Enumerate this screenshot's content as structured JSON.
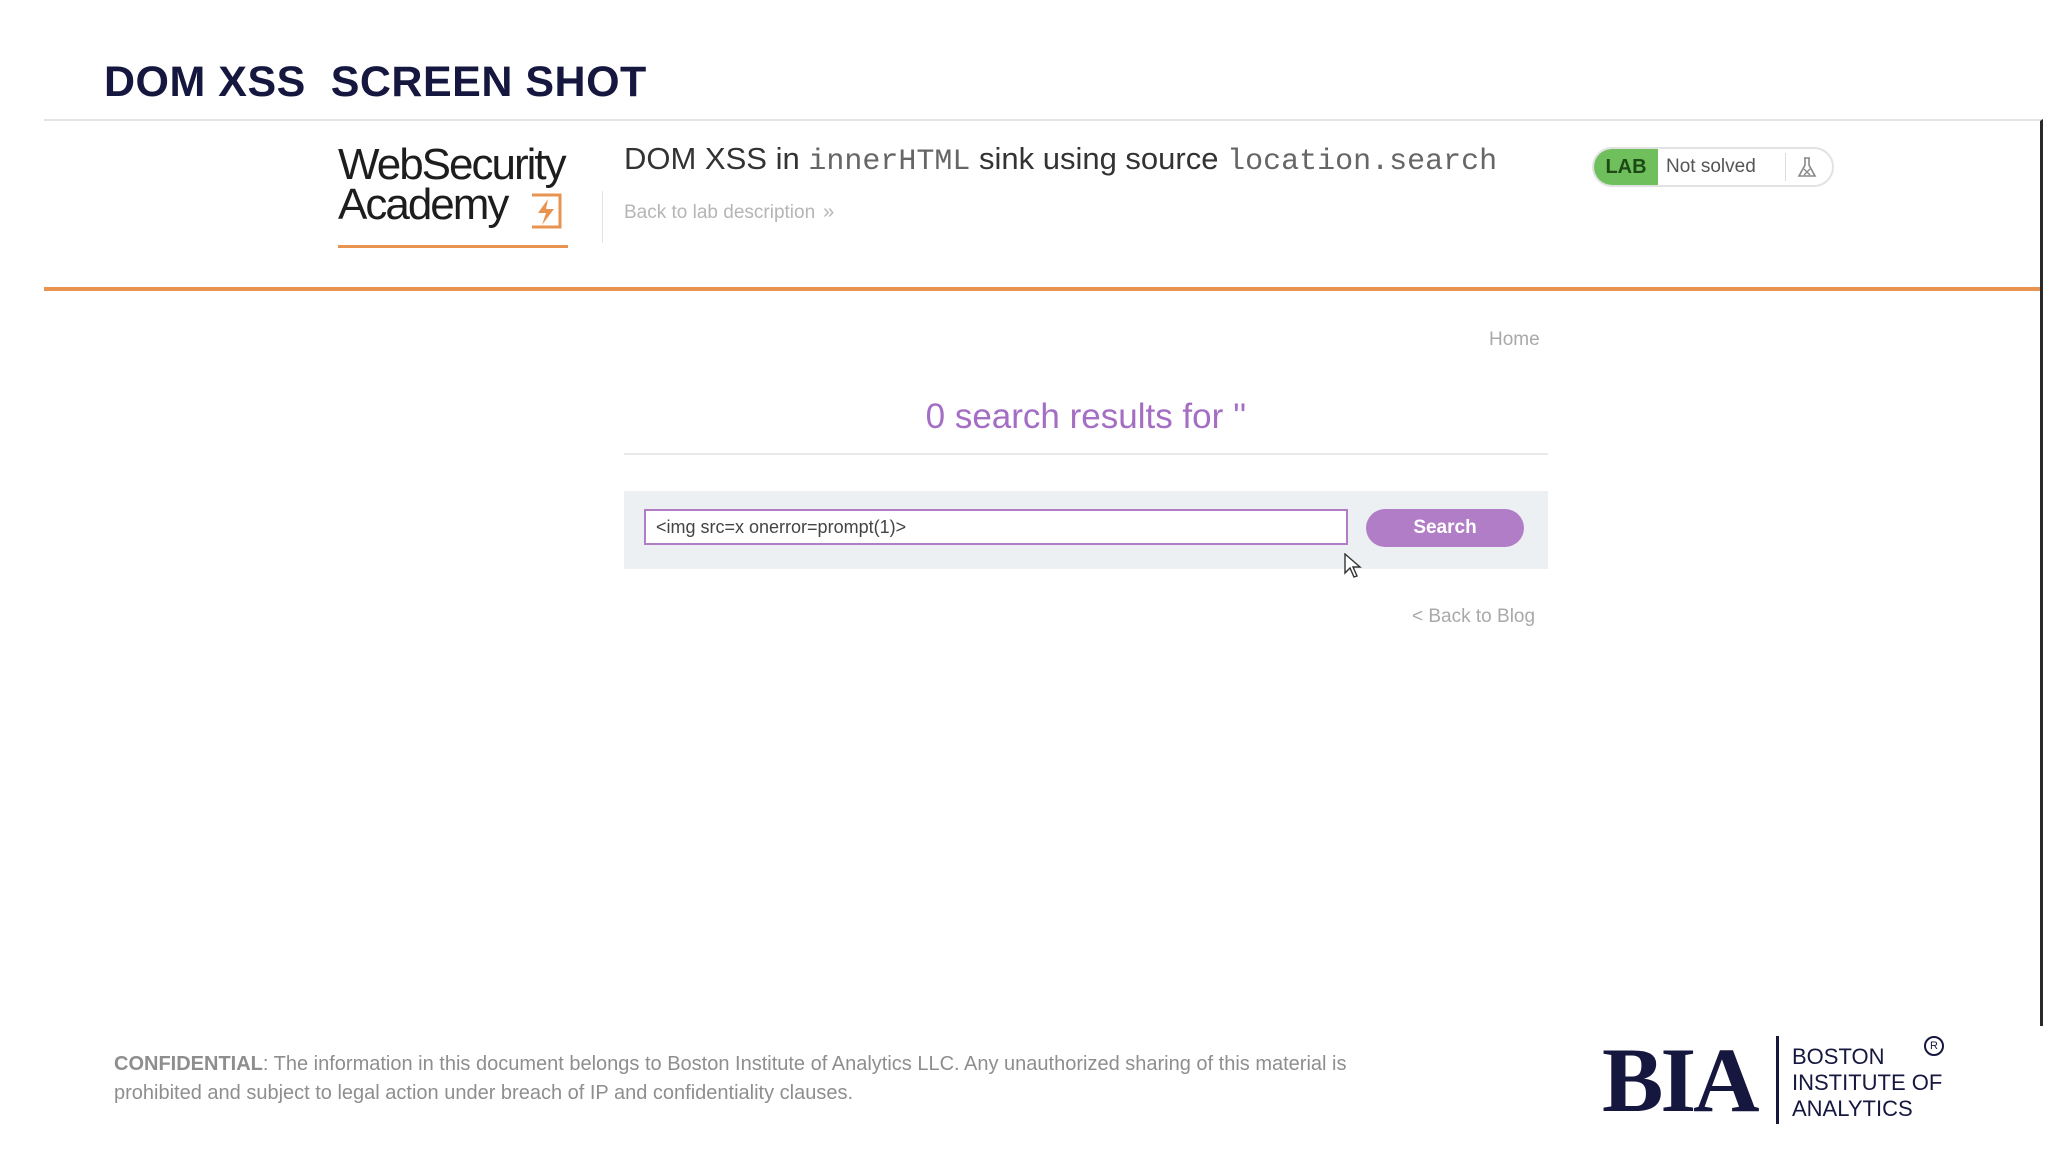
{
  "slide": {
    "title": "DOM XSS  SCREEN SHOT"
  },
  "lab": {
    "logo": {
      "line1": "WebSecurity",
      "line2": "Academy"
    },
    "title_parts": {
      "prefix": "DOM XSS in ",
      "sink": "innerHTML",
      "middle": " sink using source ",
      "source": "location.search"
    },
    "back_link": "Back to lab description",
    "back_link_chevron": "»",
    "status": {
      "badge": "LAB",
      "text": "Not solved"
    },
    "accent_color": "#e8934f"
  },
  "blog": {
    "home_link": "Home",
    "results_heading": "0 search results for ''",
    "search": {
      "value": "<img src=x onerror=prompt(1)>",
      "button_label": "Search"
    },
    "back_to_blog": "< Back to Blog",
    "accent_color": "#b07dc6"
  },
  "footer": {
    "confidential_label": "CONFIDENTIAL",
    "confidential_text": ": The information in this document belongs to Boston Institute of Analytics LLC. Any unauthorized sharing of this material is prohibited and subject to legal action under breach of IP and confidentiality clauses.",
    "brand_mark": "BIA",
    "brand_line1": "BOSTON",
    "brand_line2": "INSTITUTE OF",
    "brand_line3": "ANALYTICS",
    "registered": "R"
  }
}
